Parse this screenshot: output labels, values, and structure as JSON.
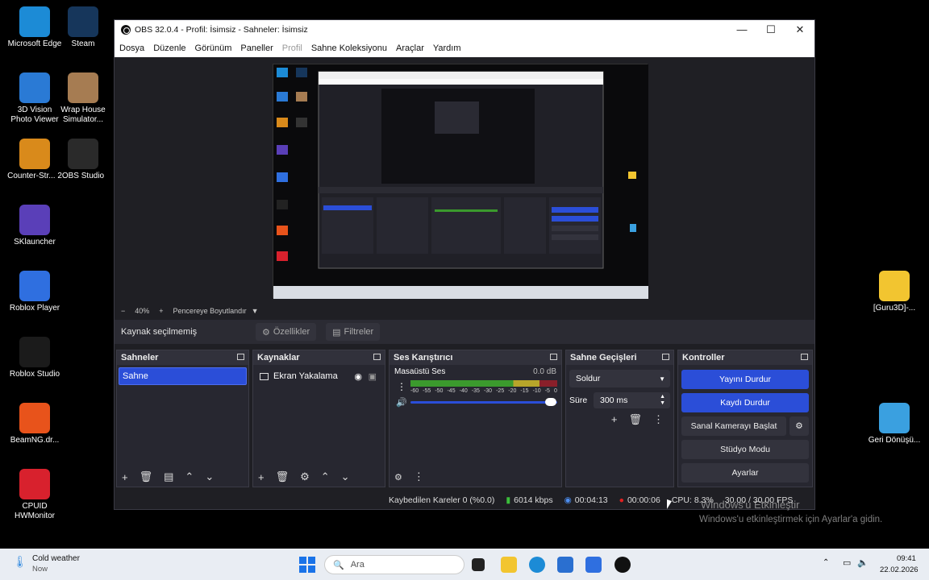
{
  "desktop": {
    "icons": [
      {
        "label": "Microsoft Edge",
        "color": "#1c8bd6"
      },
      {
        "label": "Steam",
        "color": "#16365b"
      },
      {
        "label": "3D Vision Photo Viewer",
        "color": "#2a7ad5"
      },
      {
        "label": "Wrap House Simulator...",
        "color": "#a67c52"
      },
      {
        "label": "Counter-Str... 2",
        "color": "#d98a1b"
      },
      {
        "label": "OBS Studio",
        "color": "#2a2a2a"
      },
      {
        "label": "SKlauncher",
        "color": "#5a3fb8"
      },
      {
        "label": "Roblox Player",
        "color": "#2f6fe0"
      },
      {
        "label": "Roblox Studio",
        "color": "#1b1b1b"
      },
      {
        "label": "BeamNG.dr...",
        "color": "#e8531b"
      },
      {
        "label": "CPUID HWMonitor",
        "color": "#d8212d"
      },
      {
        "label": "[Guru3D]-...",
        "color": "#f2c530"
      },
      {
        "label": "Geri Dönüşü...",
        "color": "#3aa0e0"
      }
    ]
  },
  "window": {
    "title": "OBS 32.0.4 - Profil: İsimsiz - Sahneler: İsimsiz",
    "controls": {
      "min": "—",
      "max": "☐",
      "close": "✕"
    }
  },
  "menu": [
    "Dosya",
    "Düzenle",
    "Görünüm",
    "Paneller",
    "Profil",
    "Sahne Koleksiyonu",
    "Araçlar",
    "Yardım"
  ],
  "zoom": {
    "minus": "−",
    "value": "40%",
    "plus": "+",
    "fit": "Pencereye Boyutlandır",
    "arrow": "▼"
  },
  "source_bar": {
    "label": "Kaynak seçilmemiş",
    "properties": "Özellikler",
    "filters": "Filtreler"
  },
  "scenes": {
    "title": "Sahneler",
    "items": [
      "Sahne"
    ]
  },
  "sources": {
    "title": "Kaynaklar",
    "items": [
      "Ekran Yakalama"
    ]
  },
  "mixer": {
    "title": "Ses Karıştırıcı",
    "channel": "Masaüstü Ses",
    "db": "0.0 dB",
    "ticks": [
      "-60",
      "-55",
      "-50",
      "-45",
      "-40",
      "-35",
      "-30",
      "-25",
      "-20",
      "-15",
      "-10",
      "-5",
      "0"
    ],
    "level": 0.88
  },
  "transitions": {
    "title": "Sahne Geçişleri",
    "type": "Soldur",
    "duration_label": "Süre",
    "duration": "300 ms"
  },
  "controls": {
    "title": "Kontroller",
    "stop_stream": "Yayını Durdur",
    "stop_record": "Kaydı Durdur",
    "virtual_cam": "Sanal Kamerayı Başlat",
    "studio": "Stüdyo Modu",
    "settings": "Ayarlar"
  },
  "status": {
    "dropped": "Kaybedilen Kareler 0 (%0.0)",
    "bitrate": "6014 kbps",
    "stream_time": "00:04:13",
    "rec_time": "00:00:06",
    "cpu": "CPU: 8.3%",
    "fps": "30.00 / 30.00 FPS"
  },
  "watermark": {
    "line1": "Windows'u Etkinleştir",
    "line2": "Windows'u etkinleştirmek için Ayarlar'a gidin."
  },
  "taskbar": {
    "weather_title": "Cold weather",
    "weather_sub": "Now",
    "search": "Ara",
    "time": "09:41",
    "date": "22.02.2026"
  }
}
